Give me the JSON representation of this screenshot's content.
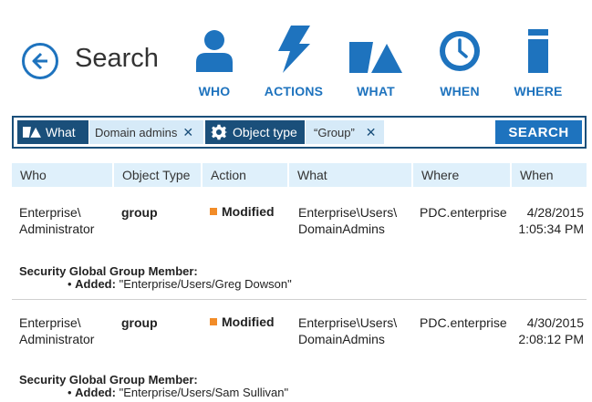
{
  "header": {
    "title": "Search",
    "categories": [
      {
        "label": "WHO",
        "icon": "user-icon"
      },
      {
        "label": "ACTIONS",
        "icon": "lightning-icon"
      },
      {
        "label": "WHAT",
        "icon": "shapes-icon"
      },
      {
        "label": "WHEN",
        "icon": "clock-icon"
      },
      {
        "label": "WHERE",
        "icon": "server-icon"
      }
    ]
  },
  "search": {
    "filters": [
      {
        "key": "What",
        "value": "Domain admins"
      },
      {
        "key": "Object type",
        "value": "“Group”"
      }
    ],
    "button_label": "SEARCH"
  },
  "table": {
    "columns": [
      "Who",
      "Object Type",
      "Action",
      "What",
      "Where",
      "When"
    ],
    "rows": [
      {
        "who_line1": "Enterprise\\",
        "who_line2": "Administrator",
        "object_type": "group",
        "action": "Modified",
        "what_line1": "Enterprise\\Users\\",
        "what_line2": "DomainAdmins",
        "where": "PDC.enterprise",
        "when_date": "4/28/2015",
        "when_time": "1:05:34 PM",
        "detail_title": "Security Global Group Member:",
        "detail_label": "Added:",
        "detail_value": "\"Enterprise/Users/Greg Dowson\""
      },
      {
        "who_line1": "Enterprise\\",
        "who_line2": "Administrator",
        "object_type": "group",
        "action": "Modified",
        "what_line1": "Enterprise\\Users\\",
        "what_line2": "DomainAdmins",
        "where": "PDC.enterprise",
        "when_date": "4/30/2015",
        "when_time": "2:08:12 PM",
        "detail_title": "Security Global Group Member:",
        "detail_label": "Added:",
        "detail_value": "\"Enterprise/Users/Sam Sullivan\""
      }
    ]
  },
  "colors": {
    "accent": "#1e73be",
    "dark": "#1a4f7a",
    "header_bg": "#dff0fb",
    "modified": "#f28c28"
  }
}
